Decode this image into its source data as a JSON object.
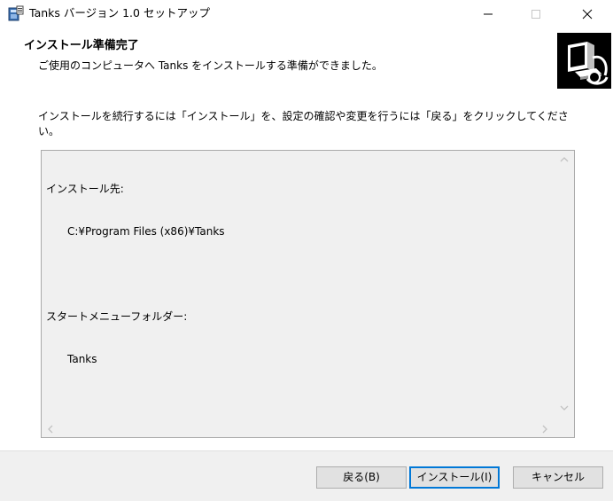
{
  "window": {
    "title": "Tanks バージョン 1.0 セットアップ",
    "app_icon": "setup-installer-icon"
  },
  "header": {
    "title": "インストール準備完了",
    "subtitle": "ご使用のコンピュータへ Tanks をインストールする準備ができました。",
    "image_icon": "computer-install-icon"
  },
  "instruction": "インストールを続行するには「インストール」を、設定の確認や変更を行うには「戻る」をクリックしてください。",
  "memo": {
    "install_dir_label": "インストール先:",
    "install_dir_value": "C:¥Program Files (x86)¥Tanks",
    "start_menu_label": "スタートメニューフォルダー:",
    "start_menu_value": "Tanks"
  },
  "buttons": {
    "back": "戻る(B)",
    "install": "インストール(I)",
    "cancel": "キャンセル"
  },
  "colors": {
    "focus_border": "#0078d7",
    "footer_bg": "#f0f0f0",
    "memo_bg": "#f0f0f0"
  }
}
